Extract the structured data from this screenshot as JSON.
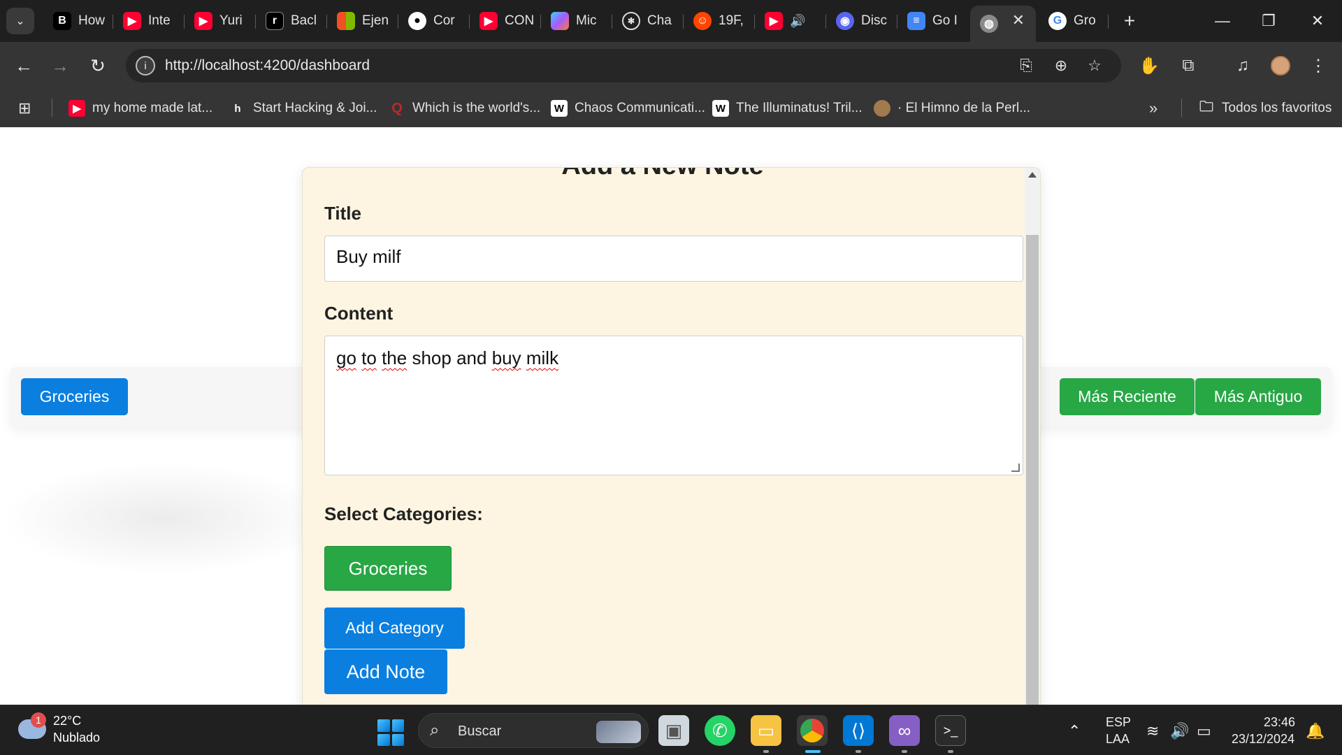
{
  "browser": {
    "tabs": [
      {
        "label": "How",
        "icon": "bold-b-icon",
        "color": "#000000"
      },
      {
        "label": "Inte",
        "icon": "youtube-icon",
        "color": "#ff0033"
      },
      {
        "label": "Yuri",
        "icon": "youtube-icon",
        "color": "#ff0033"
      },
      {
        "label": "Bacl",
        "icon": "r-logo-icon",
        "color": "#000000"
      },
      {
        "label": "Ejen",
        "icon": "microsoft-logo-icon",
        "color": "#f25022"
      },
      {
        "label": "Cor",
        "icon": "github-icon",
        "color": "#000000"
      },
      {
        "label": "CON",
        "icon": "youtube-icon",
        "color": "#ff0033"
      },
      {
        "label": "Mic",
        "icon": "copilot-icon",
        "color": "#7b61ff"
      },
      {
        "label": "Cha",
        "icon": "chatgpt-icon",
        "color": "#1f1f1f"
      },
      {
        "label": "19F,",
        "icon": "reddit-icon",
        "color": "#ff4500"
      },
      {
        "label": "",
        "icon": "youtube-icon",
        "color": "#ff0033"
      },
      {
        "label": "Disc",
        "icon": "discord-icon",
        "color": "#5865f2"
      },
      {
        "label": "Go I",
        "icon": "docs-icon",
        "color": "#4285f4"
      },
      {
        "label": "",
        "icon": "globe-icon",
        "color": "#9e9e9e"
      },
      {
        "label": "Gro",
        "icon": "google-icon",
        "color": "#ffffff"
      }
    ],
    "url": "http://localhost:4200/dashboard",
    "bookmarks": [
      {
        "label": "my home made lat...",
        "icon": "youtube-icon"
      },
      {
        "label": "Start Hacking & Joi...",
        "icon": "h-logo-icon"
      },
      {
        "label": "Which is the world's...",
        "icon": "quora-icon"
      },
      {
        "label": "Chaos Communicati...",
        "icon": "wikipedia-icon"
      },
      {
        "label": "The Illuminatus! Tril...",
        "icon": "wikipedia-icon"
      },
      {
        "label": "· El Himno de la Perl...",
        "icon": "avatar-icon"
      }
    ],
    "all_bookmarks_label": "Todos los favoritos",
    "overflow_label": "»"
  },
  "page": {
    "filter_category": "Groceries",
    "sort_newest": "Más Reciente",
    "sort_oldest": "Más Antiguo"
  },
  "modal": {
    "title": "Add a New Note",
    "title_label": "Title",
    "title_value": "Buy milf",
    "content_label": "Content",
    "content_words": [
      "go",
      "to",
      "the",
      "shop",
      "and",
      "buy",
      "milk"
    ],
    "categories_label": "Select Categories:",
    "categories": [
      "Groceries"
    ],
    "add_category_label": "Add Category",
    "add_note_label": "Add Note"
  },
  "taskbar": {
    "temperature": "22°C",
    "condition": "Nublado",
    "weather_badge": "1",
    "search_placeholder": "Buscar",
    "language": "ESP",
    "layout": "LAA",
    "time": "23:46",
    "date": "23/12/2024"
  },
  "colors": {
    "accent_blue": "#0a7fe0",
    "accent_green": "#28a745",
    "modal_bg": "#fdf5e1"
  }
}
